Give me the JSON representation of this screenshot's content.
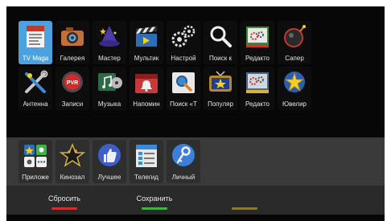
{
  "apps_row1": [
    {
      "label": "TV Maga",
      "icon": "tv-magazine-icon",
      "selected": true
    },
    {
      "label": "Галерея",
      "icon": "gallery-camera-icon"
    },
    {
      "label": "Мастер",
      "icon": "wizard-hat-icon"
    },
    {
      "label": "Мультик",
      "icon": "cartoon-clapper-icon"
    },
    {
      "label": "Настрой",
      "icon": "settings-gears-icon"
    },
    {
      "label": "Поиск к",
      "icon": "search-magnifier-icon"
    },
    {
      "label": "Редакто",
      "icon": "editor-gears-icon"
    },
    {
      "label": "Сапер",
      "icon": "minesweeper-icon"
    }
  ],
  "apps_row2": [
    {
      "label": "Антенна",
      "icon": "antenna-tools-icon"
    },
    {
      "label": "Записи",
      "icon": "pvr-recordings-icon",
      "badge": "PVR"
    },
    {
      "label": "Музыка",
      "icon": "music-icon"
    },
    {
      "label": "Напомин",
      "icon": "reminder-bell-icon"
    },
    {
      "label": "Поиск «Т",
      "icon": "search-tv-icon"
    },
    {
      "label": "Популяр",
      "icon": "popular-tv-star-icon"
    },
    {
      "label": "Редакто",
      "icon": "editor-map-icon"
    },
    {
      "label": "Ювелир",
      "icon": "jeweler-gem-icon"
    }
  ],
  "favorites": [
    {
      "label": "Приложе",
      "icon": "apps-grid-icon"
    },
    {
      "label": "Кинозал",
      "icon": "cinema-star-icon"
    },
    {
      "label": "Лучшее",
      "icon": "thumbs-up-icon"
    },
    {
      "label": "Телегид",
      "icon": "tv-guide-icon"
    },
    {
      "label": "Личный",
      "icon": "key-icon"
    }
  ],
  "footer": {
    "reset_label": "Сбросить",
    "save_label": "Сохранить",
    "third_label": ""
  },
  "colors": {
    "selected": "#4aa3e0",
    "reset_bar": "#d23030",
    "save_bar": "#3bb54a",
    "third_bar": "#8a7a3a"
  }
}
